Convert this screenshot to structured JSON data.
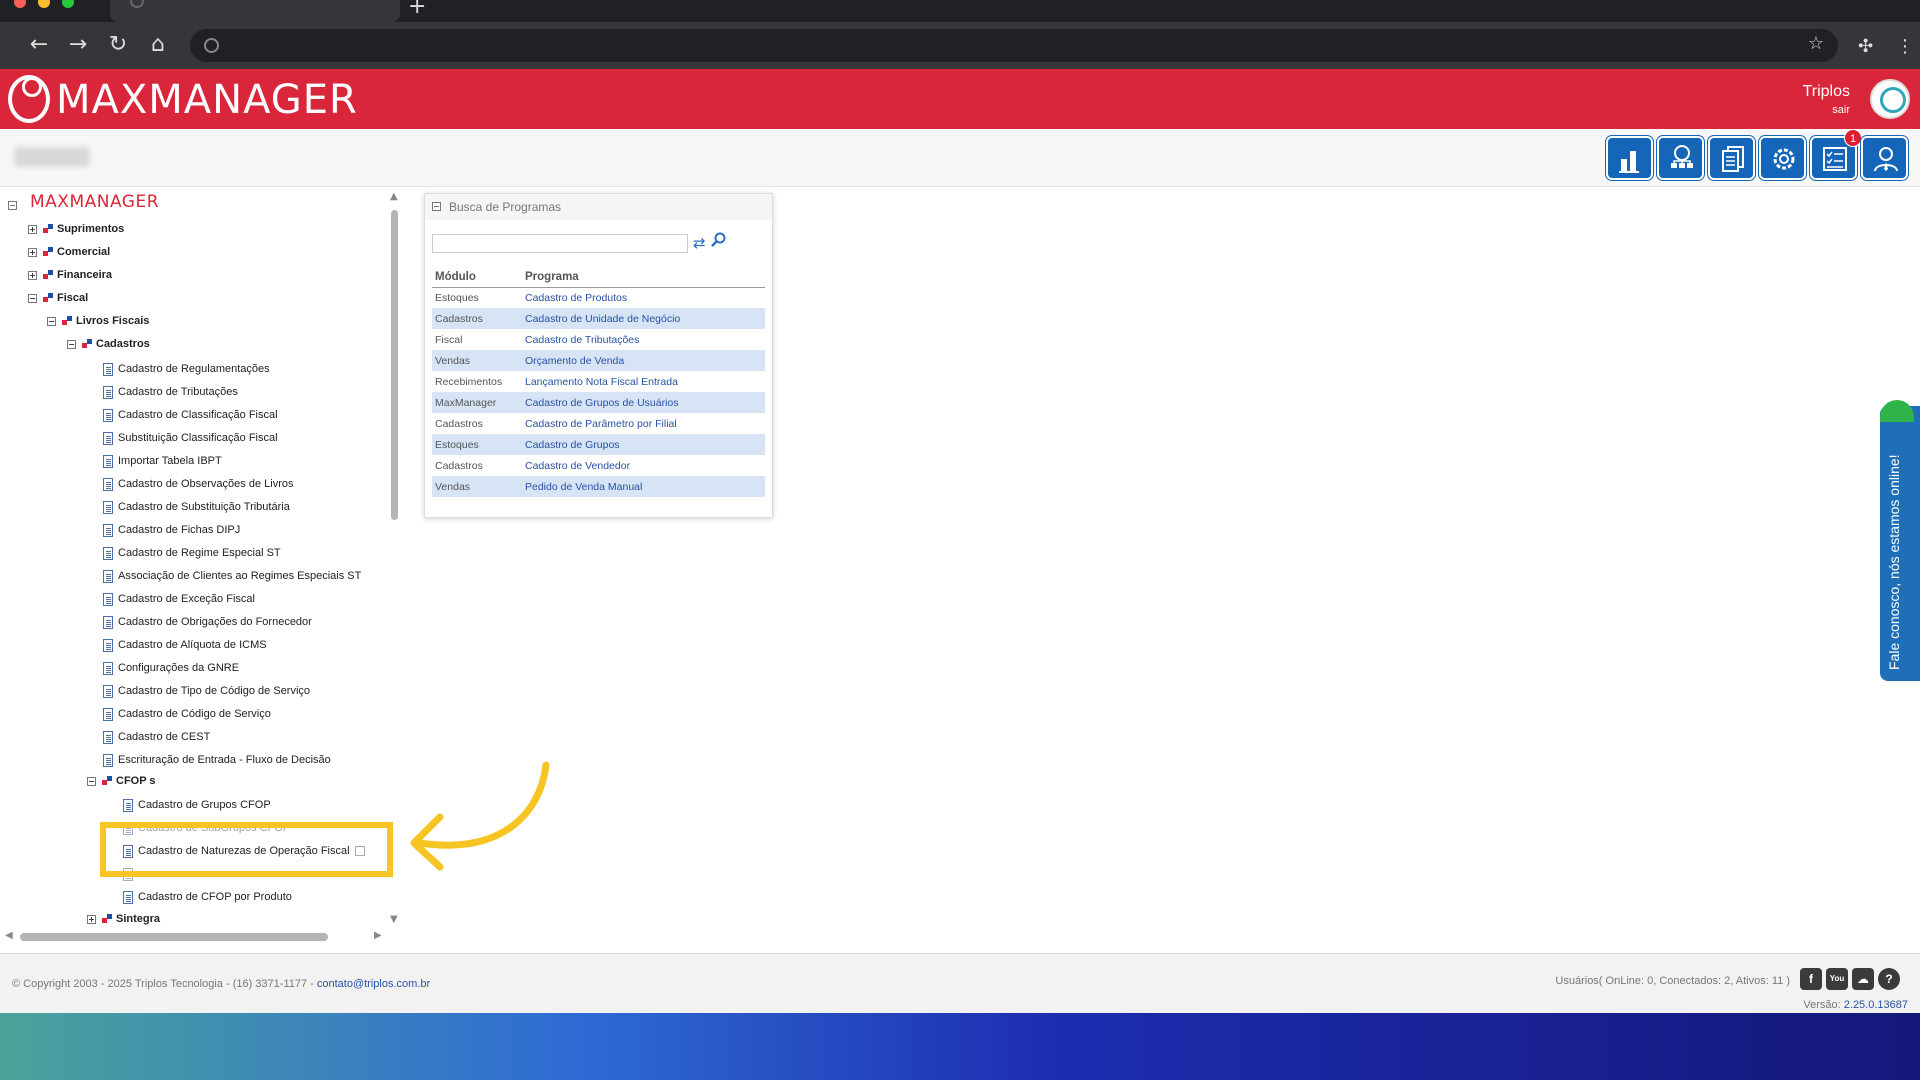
{
  "app": {
    "brand": "MAXMANAGER",
    "user_name": "Triplos",
    "logout_label": "sair",
    "header_color": "#d9263a",
    "toolbar_badge": "1"
  },
  "toolbar_icons": [
    "reports-icon",
    "network-icon",
    "documents-icon",
    "settings-gear-icon",
    "tasks-icon",
    "user-support-icon"
  ],
  "tree": {
    "root": "MAXMANAGER",
    "modules": [
      {
        "label": "Suprimentos",
        "expanded": false
      },
      {
        "label": "Comercial",
        "expanded": false
      },
      {
        "label": "Financeira",
        "expanded": false
      },
      {
        "label": "Fiscal",
        "expanded": true
      }
    ],
    "livros_fiscais": "Livros Fiscais",
    "cadastros": "Cadastros",
    "cadastros_items": [
      "Cadastro de Regulamentações",
      "Cadastro de Tributações",
      "Cadastro de Classificação Fiscal",
      "Substituição Classificação Fiscal",
      "Importar Tabela IBPT",
      "Cadastro de Observações de Livros",
      "Cadastro de Substituição Tributária",
      "Cadastro de Fichas DIPJ",
      "Cadastro de Regime Especial ST",
      "Associação de Clientes ao Regimes Especiais ST",
      "Cadastro de Exceção Fiscal",
      "Cadastro de Obrigações do Fornecedor",
      "Cadastro de Alíquota de ICMS",
      "Configurações da GNRE",
      "Cadastro de Tipo de Código de Serviço",
      "Cadastro de Código de Serviço",
      "Cadastro de CEST",
      "Escrituração de Entrada - Fluxo de Decisão"
    ],
    "cfops": "CFOP s",
    "cfop_items": [
      "Cadastro de Grupos CFOP",
      "Cadastro de SubGrupos CFOP",
      "Cadastro de Naturezas de Operação Fiscal",
      "",
      "Cadastro de CFOP por Produto"
    ],
    "sintegra": "Sintegra"
  },
  "search_panel": {
    "title": "Busca de Programas",
    "search_value": "",
    "columns": [
      "Módulo",
      "Programa"
    ],
    "rows": [
      [
        "Estoques",
        "Cadastro de Produtos"
      ],
      [
        "Cadastros",
        "Cadastro de Unidade de Negócio"
      ],
      [
        "Fiscal",
        "Cadastro de Tributações"
      ],
      [
        "Vendas",
        "Orçamento de Venda"
      ],
      [
        "Recebimentos",
        "Lançamento Nota Fiscal Entrada"
      ],
      [
        "MaxManager",
        "Cadastro de Grupos de Usuários"
      ],
      [
        "Cadastros",
        "Cadastro de Parâmetro por Filial"
      ],
      [
        "Estoques",
        "Cadastro de Grupos"
      ],
      [
        "Cadastros",
        "Cadastro de Vendedor"
      ],
      [
        "Vendas",
        "Pedido de Venda Manual"
      ]
    ]
  },
  "chat": {
    "label": "Fale conosco, nós estamos online!"
  },
  "footer": {
    "copyright": "© Copyright 2003 - 2025 Triplos Tecnologia - (16) 3371-1177 - ",
    "email": "contato@triplos.com.br",
    "online_status": "Usuários( OnLine: 0, Conectados: 2, Ativos: 11 )",
    "version_label": "Versão:",
    "version": "2.25.0.13687",
    "social": [
      "f",
      "You",
      "☁",
      "?"
    ]
  }
}
